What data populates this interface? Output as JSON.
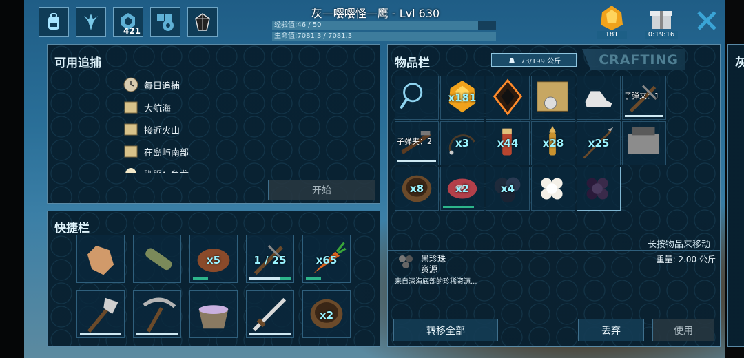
{
  "hud": {
    "player_title": "灰—嘤嘤怪—鹰 - Lvl 630",
    "xp_text": "经验值:46 / 50",
    "xp_fraction": 0.92,
    "hp_text": "生命值:7081.3 / 7081.3",
    "hp_fraction": 1.0,
    "stat_points": "421",
    "element_count": "181",
    "gift_timer": "0:19:16"
  },
  "hunts": {
    "title": "可用追捕",
    "items": [
      "每日追捕",
      "大航海",
      "接近火山",
      "在岛屿南部",
      "驯服：鱼龙"
    ],
    "start_button": "开始"
  },
  "hotbar": {
    "title": "快捷栏",
    "slots": [
      {
        "name": "hand",
        "qty": ""
      },
      {
        "name": "torch",
        "qty": ""
      },
      {
        "name": "meat",
        "qty": "x5"
      },
      {
        "name": "crossbow",
        "qty": "1 / 25"
      },
      {
        "name": "carrot",
        "qty": "x65"
      },
      {
        "name": "hatchet",
        "qty": ""
      },
      {
        "name": "pickaxe",
        "qty": ""
      },
      {
        "name": "mortar",
        "qty": ""
      },
      {
        "name": "sword",
        "qty": ""
      },
      {
        "name": "bowl",
        "qty": "x2"
      }
    ]
  },
  "inventory": {
    "title": "物品栏",
    "weight": "73/199 公斤",
    "crafting_tab": "CRAFTING",
    "slots": [
      {
        "name": "search",
        "qty": ""
      },
      {
        "name": "element",
        "qty": "x181"
      },
      {
        "name": "implant",
        "qty": ""
      },
      {
        "name": "map",
        "qty": ""
      },
      {
        "name": "cloth-boots",
        "qty": ""
      },
      {
        "name": "crossbow",
        "qty": "",
        "label": "子弹夹：1"
      },
      {
        "name": "pistol",
        "qty": "",
        "label": "子弹夹：2"
      },
      {
        "name": "whip",
        "qty": "x3"
      },
      {
        "name": "flare",
        "qty": "x44"
      },
      {
        "name": "bullet",
        "qty": "x28"
      },
      {
        "name": "spear",
        "qty": "x25"
      },
      {
        "name": "forge",
        "qty": ""
      },
      {
        "name": "bowl",
        "qty": "x8"
      },
      {
        "name": "raw-meat",
        "qty": "x2"
      },
      {
        "name": "black-pearl-cluster",
        "qty": "x4"
      },
      {
        "name": "white-pearl",
        "qty": ""
      },
      {
        "name": "black-pearl",
        "qty": ""
      }
    ],
    "hint": "长按物品来移动",
    "selected": {
      "name": "黑珍珠",
      "type": "资源",
      "weight": "重量: 2.00 公斤",
      "desc": "来自深海底部的珍稀资源..."
    },
    "transfer_all": "转移全部",
    "drop": "丢弃",
    "use": "使用"
  },
  "side_panel_char": "灰",
  "colors": {
    "accent": "#9af3ff",
    "panel": "#08202f",
    "durability": "#2db58b"
  }
}
